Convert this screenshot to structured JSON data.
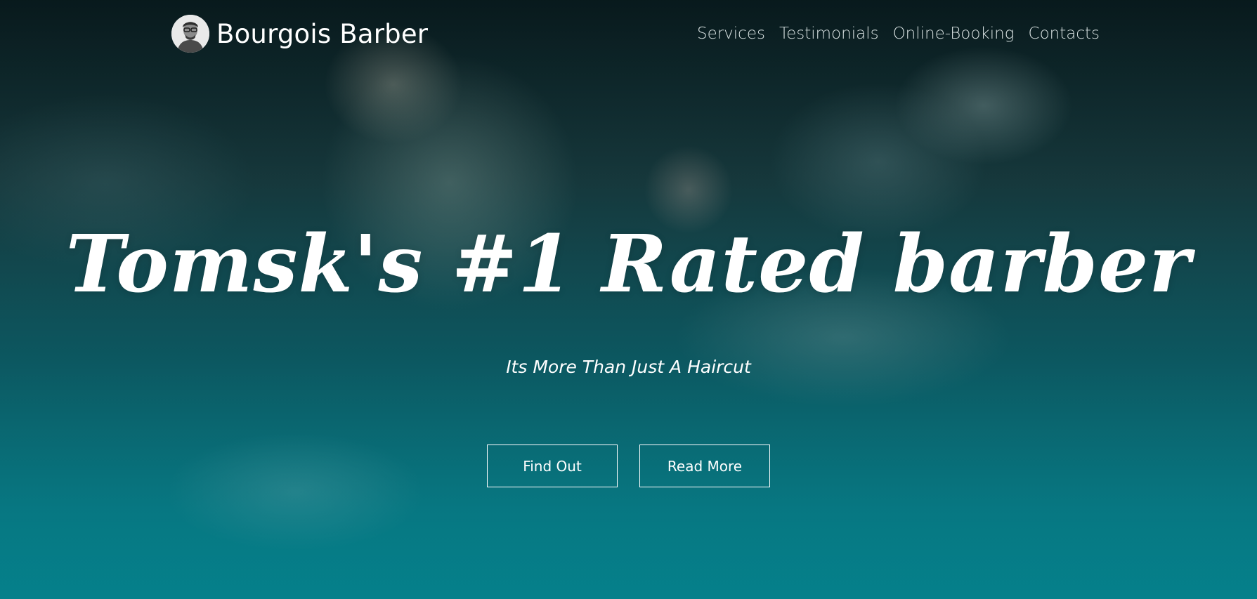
{
  "header": {
    "brand_name": "Bourgois Barber",
    "nav_links": [
      "Services",
      "Testimonials",
      "Online-Booking",
      "Contacts"
    ]
  },
  "hero": {
    "headline": "Tomsk's #1 Rated barber",
    "subheadline": "Its More Than Just A Haircut",
    "buttons": [
      "Find Out",
      "Read More"
    ]
  },
  "colors": {
    "overlay_teal": "#078a95",
    "dark_top": "#0b2226",
    "text": "#ffffff"
  },
  "icons": {
    "logo": "barber-avatar-icon"
  }
}
